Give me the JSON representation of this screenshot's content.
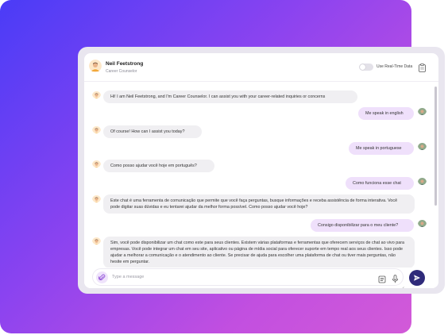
{
  "header": {
    "agent_name": "Neil Feetstrong",
    "agent_role": "Career Counselor",
    "realtime_label": "Use Real-Time Data",
    "realtime_enabled": false,
    "icons": {
      "avatar": "bot-avatar",
      "clipboard": "clipboard-icon"
    }
  },
  "messages": [
    {
      "role": "bot",
      "text": "Hi! I am Neil Feetstrong, and I'm Career Counselor. I can assist you with your career-related inquiries or concerns"
    },
    {
      "role": "user",
      "text": "Me speak in english"
    },
    {
      "role": "bot",
      "text": "Of course! How can I assist you today?"
    },
    {
      "role": "user",
      "text": "Me speak in portuguese"
    },
    {
      "role": "bot",
      "text": "Como posso ajudar você hoje em português?"
    },
    {
      "role": "user",
      "text": "Como funciona esse chat"
    },
    {
      "role": "bot",
      "text": "Este chat é uma ferramenta de comunicação que permite que você faça perguntas, busque informações e receba assistência de forma interativa. Você pode digitar suas dúvidas e eu tentarei ajudar da melhor forma possível. Como posso ajudar você hoje?"
    },
    {
      "role": "user",
      "text": "Consigo disponibilizar para o meu cliente?"
    },
    {
      "role": "bot",
      "text": "Sim, você pode disponibilizar um chat como este para seus clientes. Existem várias plataformas e ferramentas que oferecem serviços de chat ao vivo para empresas. Você pode integrar um chat em seu site, aplicativo ou página de mídia social para oferecer suporte em tempo real aos seus clientes. Isso pode ajudar a melhorar a comunicação e o atendimento ao cliente. Se precisar de ajuda para escolher uma plataforma de chat ou tiver mais perguntas, não hesite em perguntar."
    }
  ],
  "composer": {
    "placeholder": "Type a message",
    "value": "",
    "icons": [
      "paperclip-icon",
      "document-icon",
      "microphone-icon",
      "send-icon"
    ]
  },
  "colors": {
    "gradient_start": "#4a3cf7",
    "gradient_end": "#d25ad8",
    "bot_bubble": "#f0eff2",
    "user_bubble": "#efe0fb",
    "send_button": "#2f2a7a",
    "attach_button": "#efe3fb"
  }
}
